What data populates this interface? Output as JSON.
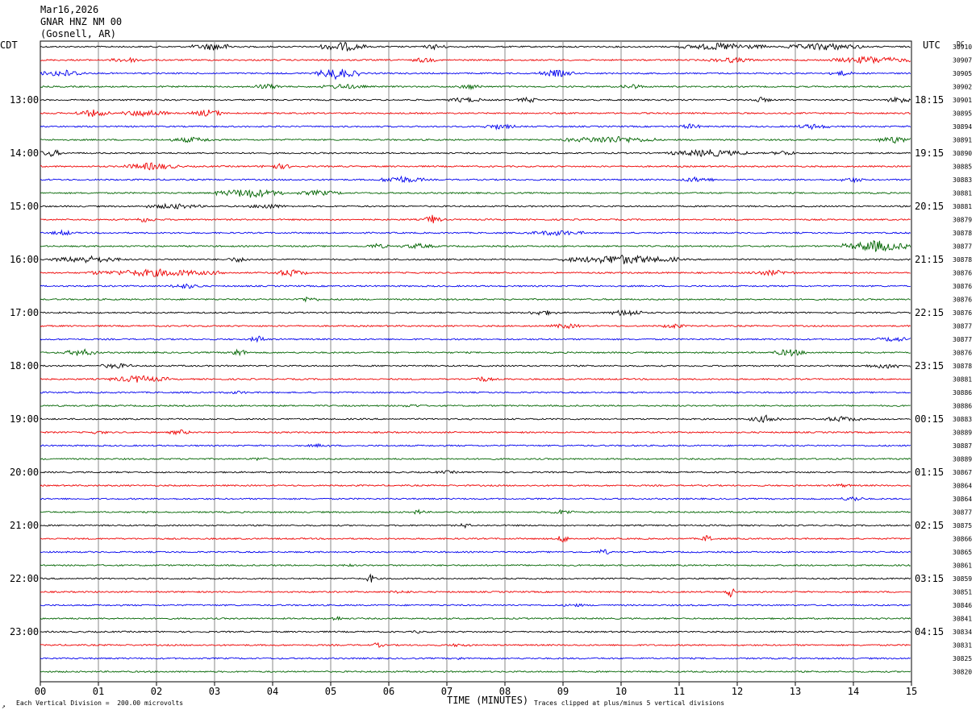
{
  "header": {
    "date": "Mar16,2026",
    "station": "GNAR HNZ NM 00",
    "location": "(Gosnell, AR)"
  },
  "left_zone": "CDT",
  "right_zone": "UTC",
  "dc_label": "DC",
  "footer": {
    "scale_note": "Each Vertical Division =  200.00 microvolts",
    "clip_note": "Traces clipped at plus/minus 5 vertical divisions"
  },
  "colors": {
    "cycle": [
      "#000000",
      "#ee0000",
      "#0000ee",
      "#006400"
    ],
    "grid": "#888888"
  },
  "chart_data": {
    "type": "line",
    "title": "GNAR HNZ NM 00",
    "xlabel": "TIME (MINUTES)",
    "xlim": [
      0,
      15
    ],
    "x_ticks": [
      "00",
      "01",
      "02",
      "03",
      "04",
      "05",
      "06",
      "07",
      "08",
      "09",
      "10",
      "11",
      "12",
      "13",
      "14",
      "15"
    ],
    "rows_per_hour": 4,
    "left_hour_labels": [
      "13:00",
      "14:00",
      "15:00",
      "16:00",
      "17:00",
      "18:00",
      "19:00",
      "20:00",
      "21:00",
      "22:00",
      "23:00"
    ],
    "right_hour_labels": [
      "18:15",
      "19:15",
      "20:15",
      "21:15",
      "22:15",
      "23:15",
      "00:15",
      "01:15",
      "02:15",
      "03:15",
      "04:15"
    ],
    "dc_offsets": [
      "30910",
      "30907",
      "30905",
      "30902",
      "30901",
      "30895",
      "30894",
      "30891",
      "30890",
      "30885",
      "30883",
      "30881",
      "30881",
      "30879",
      "30878",
      "30877",
      "30878",
      "30876",
      "30876",
      "30876",
      "30876",
      "30877",
      "30877",
      "30876",
      "30878",
      "30881",
      "30886",
      "30886",
      "30883",
      "30889",
      "30887",
      "30889",
      "30867",
      "30864",
      "30864",
      "30877",
      "30875",
      "30866",
      "30865",
      "30861",
      "30859",
      "30851",
      "30846",
      "30841",
      "30834",
      "30831",
      "30825",
      "30820"
    ],
    "activity": [
      [
        [
          2.6,
          3.4,
          3
        ],
        [
          4.8,
          5.6,
          4
        ],
        [
          6.6,
          7.0,
          2
        ],
        [
          11.0,
          12.5,
          3
        ],
        [
          12.8,
          14.2,
          3
        ]
      ],
      [
        [
          1.2,
          1.8,
          2
        ],
        [
          6.4,
          6.8,
          2
        ],
        [
          11.5,
          12.3,
          2
        ],
        [
          13.6,
          15.0,
          3
        ]
      ],
      [
        [
          0,
          0.8,
          3
        ],
        [
          4.7,
          5.5,
          5
        ],
        [
          8.6,
          9.2,
          3
        ],
        [
          13.6,
          14.0,
          2
        ]
      ],
      [
        [
          3.6,
          4.2,
          2
        ],
        [
          4.8,
          5.6,
          2
        ],
        [
          7.2,
          7.6,
          2
        ],
        [
          10.0,
          10.4,
          2
        ]
      ],
      [
        [
          7.0,
          7.6,
          2
        ],
        [
          8.2,
          8.6,
          2
        ],
        [
          12.2,
          12.6,
          2
        ],
        [
          14.6,
          15.0,
          3
        ]
      ],
      [
        [
          0.6,
          1.2,
          3
        ],
        [
          1.4,
          2.2,
          3
        ],
        [
          2.6,
          3.2,
          3
        ]
      ],
      [
        [
          7.6,
          8.2,
          2
        ],
        [
          11.0,
          11.4,
          2
        ],
        [
          13.0,
          13.6,
          2
        ]
      ],
      [
        [
          2.2,
          3.0,
          2
        ],
        [
          9.0,
          10.6,
          3
        ],
        [
          14.4,
          15.0,
          3
        ]
      ],
      [
        [
          0,
          0.4,
          3
        ],
        [
          10.8,
          12.2,
          3
        ],
        [
          12.6,
          13.0,
          2
        ]
      ],
      [
        [
          1.4,
          2.4,
          3
        ],
        [
          3.8,
          4.4,
          2
        ]
      ],
      [
        [
          5.8,
          6.6,
          3
        ],
        [
          11.0,
          11.6,
          2
        ],
        [
          13.8,
          14.2,
          2
        ]
      ],
      [
        [
          3.0,
          4.2,
          4
        ],
        [
          4.4,
          5.2,
          2
        ]
      ],
      [
        [
          1.8,
          2.8,
          2
        ],
        [
          3.6,
          4.2,
          2
        ]
      ],
      [
        [
          6.6,
          6.9,
          4
        ],
        [
          1.6,
          2.0,
          2
        ]
      ],
      [
        [
          8.4,
          9.4,
          2
        ],
        [
          0.2,
          0.6,
          2
        ]
      ],
      [
        [
          5.6,
          6.0,
          2
        ],
        [
          6.2,
          6.8,
          2
        ],
        [
          13.8,
          15.0,
          5
        ]
      ],
      [
        [
          0.2,
          1.4,
          3
        ],
        [
          3.2,
          3.6,
          2
        ],
        [
          9.0,
          11.0,
          4
        ]
      ],
      [
        [
          0.8,
          3.2,
          3
        ],
        [
          4.0,
          4.6,
          3
        ],
        [
          12.2,
          13.0,
          2
        ]
      ],
      [
        [
          2.2,
          2.8,
          2
        ]
      ],
      [
        [
          4.4,
          4.8,
          2
        ]
      ],
      [
        [
          8.4,
          8.9,
          2
        ],
        [
          9.8,
          10.4,
          3
        ]
      ],
      [
        [
          8.8,
          9.3,
          2
        ],
        [
          10.7,
          11.1,
          2
        ]
      ],
      [
        [
          3.6,
          3.9,
          3
        ],
        [
          14.4,
          15.0,
          2
        ]
      ],
      [
        [
          0.4,
          1.0,
          3
        ],
        [
          3.2,
          3.6,
          3
        ],
        [
          12.6,
          13.2,
          3
        ]
      ],
      [
        [
          1.0,
          1.6,
          2
        ],
        [
          14.2,
          15.0,
          2
        ]
      ],
      [
        [
          1.2,
          2.2,
          3
        ],
        [
          7.4,
          7.8,
          2
        ]
      ],
      [
        [
          3.2,
          3.6,
          1
        ]
      ],
      [
        [
          6.2,
          6.6,
          1
        ]
      ],
      [
        [
          12.2,
          12.8,
          3
        ],
        [
          13.4,
          14.2,
          2
        ]
      ],
      [
        [
          2.2,
          2.6,
          2
        ],
        [
          0.8,
          1.2,
          1
        ]
      ],
      [
        [
          4.6,
          5.0,
          1
        ]
      ],
      [
        [
          3.6,
          3.9,
          1
        ]
      ],
      [
        [
          6.8,
          7.2,
          1
        ]
      ],
      [
        [
          13.6,
          14.0,
          1
        ]
      ],
      [
        [
          13.8,
          14.2,
          2
        ]
      ],
      [
        [
          6.4,
          6.6,
          2
        ],
        [
          8.8,
          9.2,
          2
        ]
      ],
      [
        [
          7.2,
          7.4,
          2
        ]
      ],
      [
        [
          8.9,
          9.1,
          4
        ],
        [
          11.4,
          11.6,
          4
        ]
      ],
      [
        [
          9.6,
          9.8,
          3
        ]
      ],
      [
        [
          5.2,
          5.4,
          1
        ]
      ],
      [
        [
          5.6,
          5.8,
          4
        ]
      ],
      [
        [
          6.0,
          6.4,
          1
        ],
        [
          11.8,
          12.0,
          5
        ]
      ],
      [
        [
          9.0,
          9.4,
          1
        ]
      ],
      [
        [
          5.0,
          5.2,
          2
        ]
      ],
      [
        [
          6.4,
          6.6,
          1
        ]
      ],
      [
        [
          5.7,
          5.9,
          2
        ],
        [
          7.0,
          7.4,
          1
        ]
      ],
      [
        [
          7.1,
          7.3,
          1
        ]
      ],
      [
        []
      ]
    ]
  }
}
